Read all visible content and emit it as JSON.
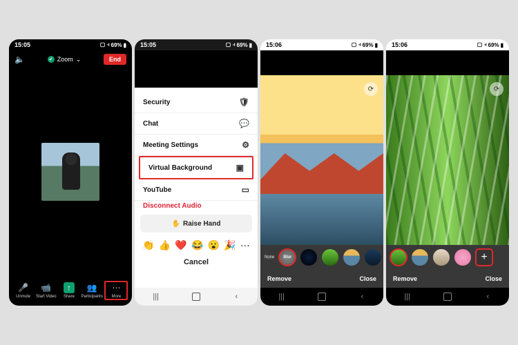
{
  "status": {
    "time": "15:05",
    "time_b": "15:06",
    "battery": "69%",
    "signal": "▢ ◊ ⫞"
  },
  "s1": {
    "zoom_label": "Zoom",
    "end": "End",
    "bottom": [
      {
        "label": "Unmute"
      },
      {
        "label": "Start Video"
      },
      {
        "label": "Share"
      },
      {
        "label": "Participants"
      },
      {
        "label": "More"
      }
    ]
  },
  "s2": {
    "menu": [
      {
        "label": "Security"
      },
      {
        "label": "Chat"
      },
      {
        "label": "Meeting Settings"
      },
      {
        "label": "Virtual Background"
      },
      {
        "label": "YouTube"
      },
      {
        "label": "Disconnect Audio"
      }
    ],
    "raise": "Raise Hand",
    "cancel": "Cancel",
    "emojis": [
      "👏",
      "👍",
      "❤️",
      "😂",
      "😮",
      "🎉",
      "···"
    ]
  },
  "s3": {
    "none": "None",
    "blur": "Blur",
    "remove": "Remove",
    "close": "Close"
  },
  "colors": {
    "accent_red": "#e02828",
    "accent_green": "#0e9f6e"
  }
}
